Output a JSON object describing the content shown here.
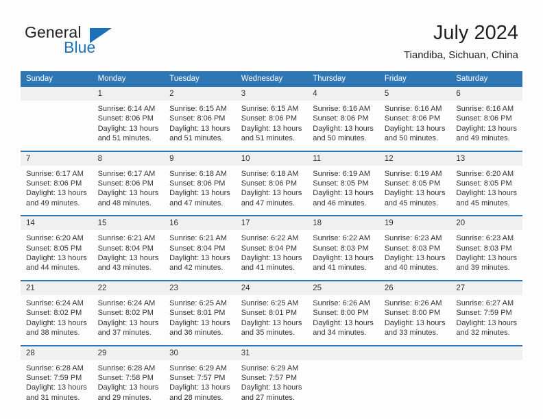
{
  "logo": {
    "word1": "General",
    "word2": "Blue",
    "triangle_color": "#1b72b8",
    "text_color": "#231f20"
  },
  "header": {
    "title": "July 2024",
    "subtitle": "Tiandiba, Sichuan, China"
  },
  "theme": {
    "header_bg": "#2f76b5",
    "header_text": "#ffffff",
    "daynum_bg": "#f0f0f0",
    "body_bg": "#fdfdfd",
    "text": "#333333",
    "separator": "#2f76b5"
  },
  "weekdays": [
    "Sunday",
    "Monday",
    "Tuesday",
    "Wednesday",
    "Thursday",
    "Friday",
    "Saturday"
  ],
  "weeks": [
    {
      "days": [
        {
          "num": "",
          "lines": []
        },
        {
          "num": "1",
          "lines": [
            "Sunrise: 6:14 AM",
            "Sunset: 8:06 PM",
            "Daylight: 13 hours",
            "and 51 minutes."
          ]
        },
        {
          "num": "2",
          "lines": [
            "Sunrise: 6:15 AM",
            "Sunset: 8:06 PM",
            "Daylight: 13 hours",
            "and 51 minutes."
          ]
        },
        {
          "num": "3",
          "lines": [
            "Sunrise: 6:15 AM",
            "Sunset: 8:06 PM",
            "Daylight: 13 hours",
            "and 51 minutes."
          ]
        },
        {
          "num": "4",
          "lines": [
            "Sunrise: 6:16 AM",
            "Sunset: 8:06 PM",
            "Daylight: 13 hours",
            "and 50 minutes."
          ]
        },
        {
          "num": "5",
          "lines": [
            "Sunrise: 6:16 AM",
            "Sunset: 8:06 PM",
            "Daylight: 13 hours",
            "and 50 minutes."
          ]
        },
        {
          "num": "6",
          "lines": [
            "Sunrise: 6:16 AM",
            "Sunset: 8:06 PM",
            "Daylight: 13 hours",
            "and 49 minutes."
          ]
        }
      ]
    },
    {
      "days": [
        {
          "num": "7",
          "lines": [
            "Sunrise: 6:17 AM",
            "Sunset: 8:06 PM",
            "Daylight: 13 hours",
            "and 49 minutes."
          ]
        },
        {
          "num": "8",
          "lines": [
            "Sunrise: 6:17 AM",
            "Sunset: 8:06 PM",
            "Daylight: 13 hours",
            "and 48 minutes."
          ]
        },
        {
          "num": "9",
          "lines": [
            "Sunrise: 6:18 AM",
            "Sunset: 8:06 PM",
            "Daylight: 13 hours",
            "and 47 minutes."
          ]
        },
        {
          "num": "10",
          "lines": [
            "Sunrise: 6:18 AM",
            "Sunset: 8:06 PM",
            "Daylight: 13 hours",
            "and 47 minutes."
          ]
        },
        {
          "num": "11",
          "lines": [
            "Sunrise: 6:19 AM",
            "Sunset: 8:05 PM",
            "Daylight: 13 hours",
            "and 46 minutes."
          ]
        },
        {
          "num": "12",
          "lines": [
            "Sunrise: 6:19 AM",
            "Sunset: 8:05 PM",
            "Daylight: 13 hours",
            "and 45 minutes."
          ]
        },
        {
          "num": "13",
          "lines": [
            "Sunrise: 6:20 AM",
            "Sunset: 8:05 PM",
            "Daylight: 13 hours",
            "and 45 minutes."
          ]
        }
      ]
    },
    {
      "days": [
        {
          "num": "14",
          "lines": [
            "Sunrise: 6:20 AM",
            "Sunset: 8:05 PM",
            "Daylight: 13 hours",
            "and 44 minutes."
          ]
        },
        {
          "num": "15",
          "lines": [
            "Sunrise: 6:21 AM",
            "Sunset: 8:04 PM",
            "Daylight: 13 hours",
            "and 43 minutes."
          ]
        },
        {
          "num": "16",
          "lines": [
            "Sunrise: 6:21 AM",
            "Sunset: 8:04 PM",
            "Daylight: 13 hours",
            "and 42 minutes."
          ]
        },
        {
          "num": "17",
          "lines": [
            "Sunrise: 6:22 AM",
            "Sunset: 8:04 PM",
            "Daylight: 13 hours",
            "and 41 minutes."
          ]
        },
        {
          "num": "18",
          "lines": [
            "Sunrise: 6:22 AM",
            "Sunset: 8:03 PM",
            "Daylight: 13 hours",
            "and 41 minutes."
          ]
        },
        {
          "num": "19",
          "lines": [
            "Sunrise: 6:23 AM",
            "Sunset: 8:03 PM",
            "Daylight: 13 hours",
            "and 40 minutes."
          ]
        },
        {
          "num": "20",
          "lines": [
            "Sunrise: 6:23 AM",
            "Sunset: 8:03 PM",
            "Daylight: 13 hours",
            "and 39 minutes."
          ]
        }
      ]
    },
    {
      "days": [
        {
          "num": "21",
          "lines": [
            "Sunrise: 6:24 AM",
            "Sunset: 8:02 PM",
            "Daylight: 13 hours",
            "and 38 minutes."
          ]
        },
        {
          "num": "22",
          "lines": [
            "Sunrise: 6:24 AM",
            "Sunset: 8:02 PM",
            "Daylight: 13 hours",
            "and 37 minutes."
          ]
        },
        {
          "num": "23",
          "lines": [
            "Sunrise: 6:25 AM",
            "Sunset: 8:01 PM",
            "Daylight: 13 hours",
            "and 36 minutes."
          ]
        },
        {
          "num": "24",
          "lines": [
            "Sunrise: 6:25 AM",
            "Sunset: 8:01 PM",
            "Daylight: 13 hours",
            "and 35 minutes."
          ]
        },
        {
          "num": "25",
          "lines": [
            "Sunrise: 6:26 AM",
            "Sunset: 8:00 PM",
            "Daylight: 13 hours",
            "and 34 minutes."
          ]
        },
        {
          "num": "26",
          "lines": [
            "Sunrise: 6:26 AM",
            "Sunset: 8:00 PM",
            "Daylight: 13 hours",
            "and 33 minutes."
          ]
        },
        {
          "num": "27",
          "lines": [
            "Sunrise: 6:27 AM",
            "Sunset: 7:59 PM",
            "Daylight: 13 hours",
            "and 32 minutes."
          ]
        }
      ]
    },
    {
      "days": [
        {
          "num": "28",
          "lines": [
            "Sunrise: 6:28 AM",
            "Sunset: 7:59 PM",
            "Daylight: 13 hours",
            "and 31 minutes."
          ]
        },
        {
          "num": "29",
          "lines": [
            "Sunrise: 6:28 AM",
            "Sunset: 7:58 PM",
            "Daylight: 13 hours",
            "and 29 minutes."
          ]
        },
        {
          "num": "30",
          "lines": [
            "Sunrise: 6:29 AM",
            "Sunset: 7:57 PM",
            "Daylight: 13 hours",
            "and 28 minutes."
          ]
        },
        {
          "num": "31",
          "lines": [
            "Sunrise: 6:29 AM",
            "Sunset: 7:57 PM",
            "Daylight: 13 hours",
            "and 27 minutes."
          ]
        },
        {
          "num": "",
          "lines": []
        },
        {
          "num": "",
          "lines": []
        },
        {
          "num": "",
          "lines": []
        }
      ]
    }
  ]
}
